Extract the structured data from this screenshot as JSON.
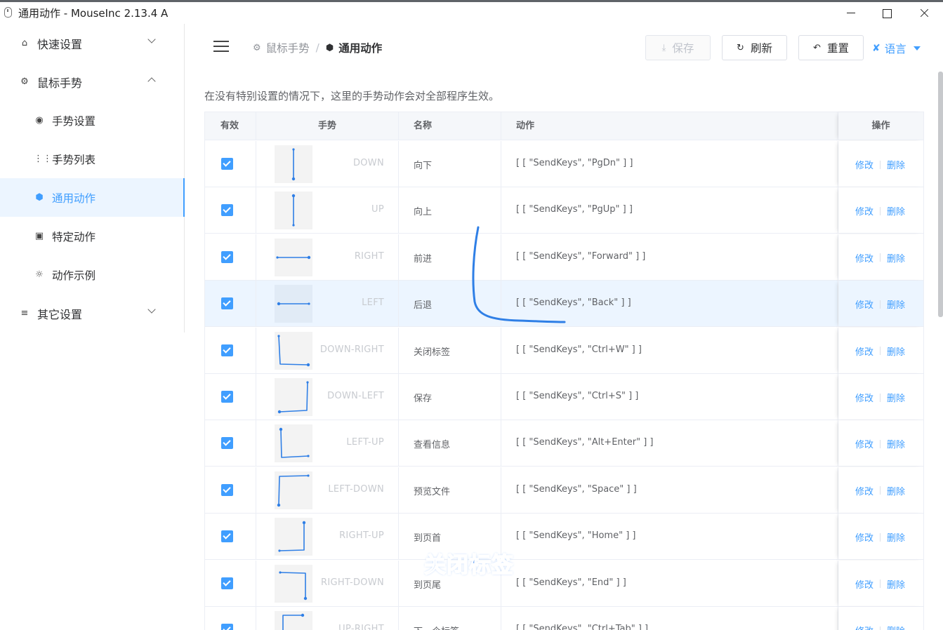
{
  "window": {
    "title": "通用动作 - MouseInc 2.13.4 A"
  },
  "sidebar": {
    "items": [
      {
        "label": "快速设置",
        "icon": "home-icon",
        "level": 1,
        "arrow": "down"
      },
      {
        "label": "鼠标手势",
        "icon": "gear-icon",
        "level": 1,
        "arrow": "up"
      },
      {
        "label": "手势设置",
        "icon": "palette-icon",
        "level": 2
      },
      {
        "label": "手势列表",
        "icon": "grid-icon",
        "level": 2
      },
      {
        "label": "通用动作",
        "icon": "cube-icon",
        "level": 2,
        "active": true
      },
      {
        "label": "特定动作",
        "icon": "briefcase-icon",
        "level": 2
      },
      {
        "label": "动作示例",
        "icon": "bulb-icon",
        "level": 2
      },
      {
        "label": "其它设置",
        "icon": "sliders-icon",
        "level": 1,
        "arrow": "down"
      }
    ]
  },
  "header": {
    "breadcrumb": {
      "parent": "鼠标手势",
      "current": "通用动作"
    },
    "save_label": "保存",
    "refresh_label": "刷新",
    "reset_label": "重置",
    "language_label": "语言"
  },
  "main": {
    "description": "在没有特别设置的情况下，这里的手势动作会对全部程序生效。",
    "columns": {
      "valid": "有效",
      "gesture": "手势",
      "name": "名称",
      "action": "动作",
      "ops": "操作"
    },
    "edit_label": "修改",
    "delete_label": "删除",
    "rows": [
      {
        "gesture": "DOWN",
        "name": "向下",
        "action": "[ [ \"SendKeys\", \"PgDn\" ] ]",
        "checked": true
      },
      {
        "gesture": "UP",
        "name": "向上",
        "action": "[ [ \"SendKeys\", \"PgUp\" ] ]",
        "checked": true
      },
      {
        "gesture": "RIGHT",
        "name": "前进",
        "action": "[ [ \"SendKeys\", \"Forward\" ] ]",
        "checked": true
      },
      {
        "gesture": "LEFT",
        "name": "后退",
        "action": "[ [ \"SendKeys\", \"Back\" ] ]",
        "checked": true,
        "highlight": true
      },
      {
        "gesture": "DOWN-RIGHT",
        "name": "关闭标签",
        "action": "[ [ \"SendKeys\", \"Ctrl+W\" ] ]",
        "checked": true
      },
      {
        "gesture": "DOWN-LEFT",
        "name": "保存",
        "action": "[ [ \"SendKeys\", \"Ctrl+S\" ] ]",
        "checked": true
      },
      {
        "gesture": "LEFT-UP",
        "name": "查看信息",
        "action": "[ [ \"SendKeys\", \"Alt+Enter\" ] ]",
        "checked": true
      },
      {
        "gesture": "LEFT-DOWN",
        "name": "预览文件",
        "action": "[ [ \"SendKeys\", \"Space\" ] ]",
        "checked": true
      },
      {
        "gesture": "RIGHT-UP",
        "name": "到页首",
        "action": "[ [ \"SendKeys\", \"Home\" ] ]",
        "checked": true
      },
      {
        "gesture": "RIGHT-DOWN",
        "name": "到页尾",
        "action": "[ [ \"SendKeys\", \"End\" ] ]",
        "checked": true
      },
      {
        "gesture": "UP-RIGHT",
        "name": "下一个标签",
        "action": "[ [ \"SendKeys\", \"Ctrl+Tab\" ] ]",
        "checked": true
      }
    ]
  },
  "overlay": {
    "caption": "关闭标签"
  },
  "colors": {
    "accent": "#409eff",
    "active_bg": "#ecf5ff",
    "stroke": "#2f7fe6"
  }
}
